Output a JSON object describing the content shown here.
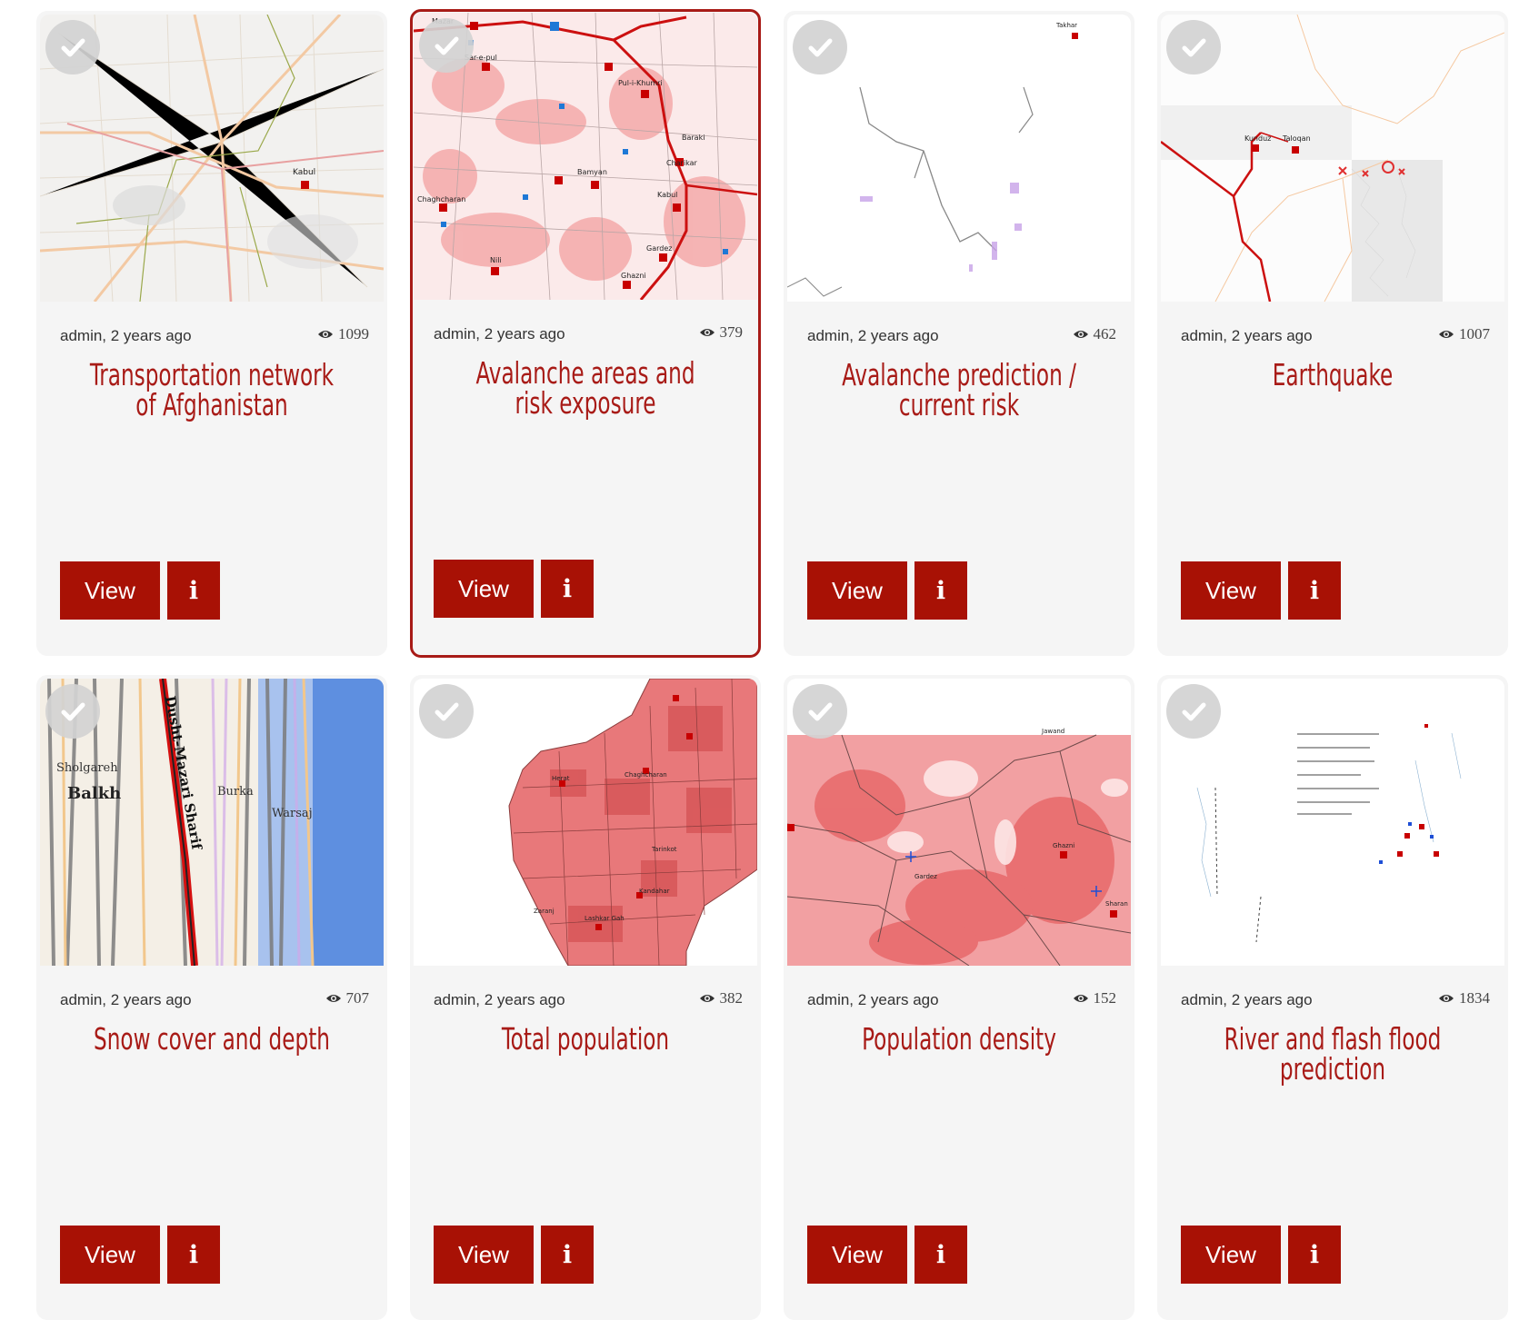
{
  "cards": [
    {
      "author": "admin, 2 years ago",
      "views": "1099",
      "title": "Transportation network of Afghanistan",
      "view_label": "View",
      "info_label": "i",
      "thumbnail": "transportation-map"
    },
    {
      "author": "admin, 2 years ago",
      "views": "379",
      "title": "Avalanche areas and risk exposure",
      "view_label": "View",
      "info_label": "i",
      "thumbnail": "avalanche-risk-map",
      "selected": true
    },
    {
      "author": "admin, 2 years ago",
      "views": "462",
      "title": "Avalanche prediction / current risk",
      "view_label": "View",
      "info_label": "i",
      "thumbnail": "avalanche-prediction-map"
    },
    {
      "author": "admin, 2 years ago",
      "views": "1007",
      "title": "Earthquake",
      "view_label": "View",
      "info_label": "i",
      "thumbnail": "earthquake-map"
    },
    {
      "author": "admin, 2 years ago",
      "views": "707",
      "title": "Snow cover and depth",
      "view_label": "View",
      "info_label": "i",
      "thumbnail": "snow-cover-map"
    },
    {
      "author": "admin, 2 years ago",
      "views": "382",
      "title": "Total population",
      "view_label": "View",
      "info_label": "i",
      "thumbnail": "population-map"
    },
    {
      "author": "admin, 2 years ago",
      "views": "152",
      "title": "Population density",
      "view_label": "View",
      "info_label": "i",
      "thumbnail": "population-density-map"
    },
    {
      "author": "admin, 2 years ago",
      "views": "1834",
      "title": "River and flash flood prediction",
      "view_label": "View",
      "info_label": "i",
      "thumbnail": "flood-prediction-map"
    }
  ],
  "map_labels": {
    "transportation": [
      "Kabul"
    ],
    "avalanche_risk": [
      "Chaghcharan",
      "Bamyan",
      "Kabul",
      "Pul-i-Khumri",
      "Sar-e-pul",
      "Ghazni",
      "Gardez",
      "Nili",
      "Baraki",
      "Charikar",
      "Mazar"
    ],
    "avalanche_prediction": [
      "Takhar"
    ],
    "earthquake": [
      "Kunduz",
      "Taloqan"
    ],
    "snow_cover": [
      "Sholgareh",
      "Balkh",
      "Dusht-Mazari Sharif",
      "Burka",
      "Warsaj"
    ],
    "population": [
      "Chaghcharan",
      "Herat",
      "Kandahar",
      "Zaranj",
      "Tarinkot",
      "Lashkar Gah"
    ],
    "population_density": [
      "Ghazni",
      "Gardez",
      "Sharan",
      "Jawand"
    ]
  },
  "colors": {
    "accent": "#a81b17",
    "button": "#a81105",
    "card_bg": "#f5f5f5"
  },
  "icons": {
    "views": "eye-icon",
    "select": "check-icon"
  }
}
